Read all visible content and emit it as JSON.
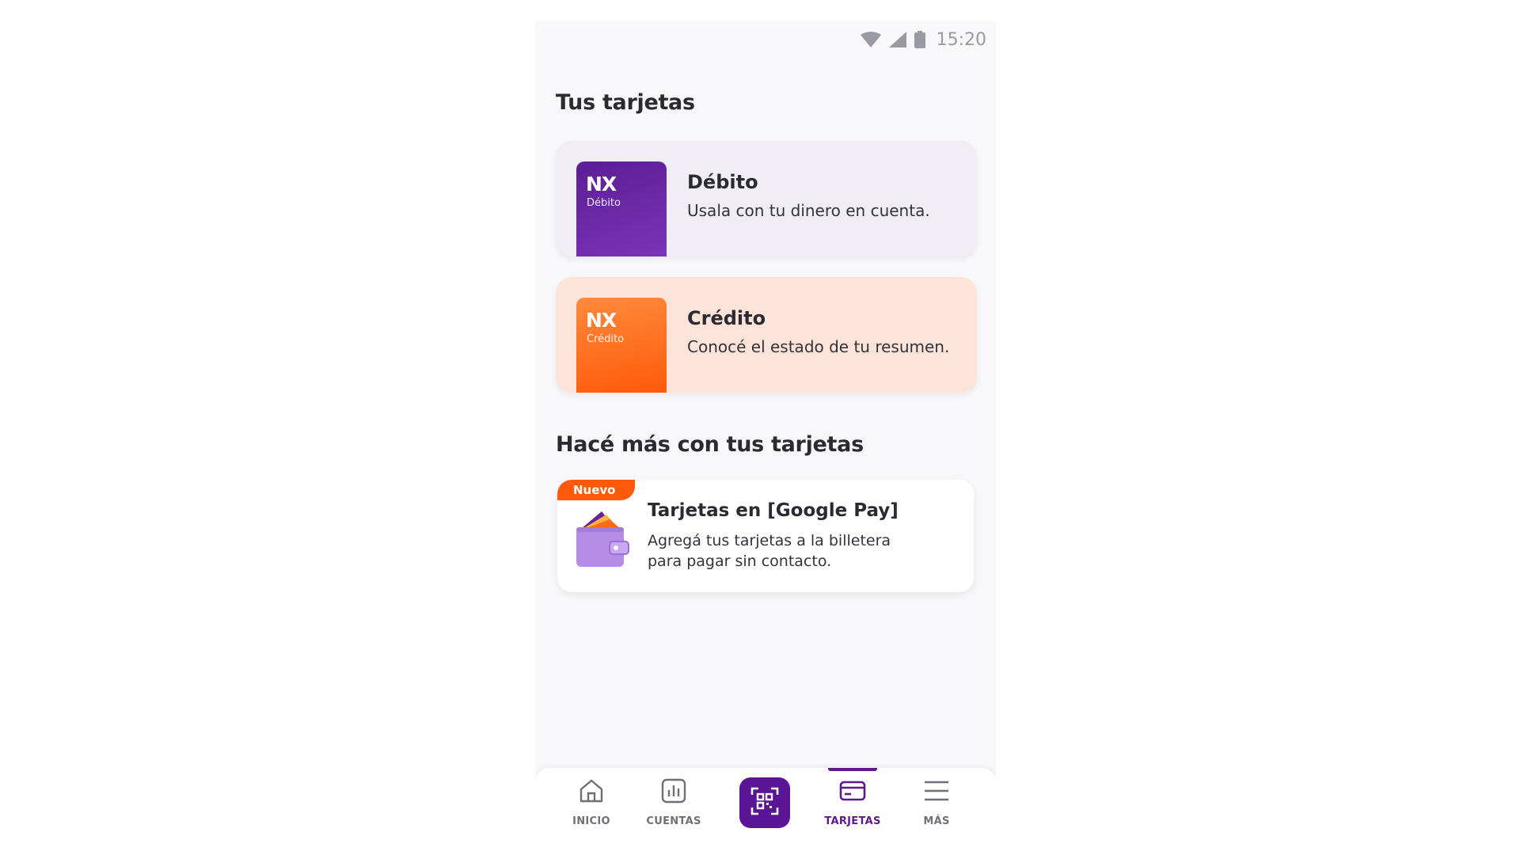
{
  "status_bar": {
    "time": "15:20",
    "icons": [
      "wifi-icon",
      "signal-icon",
      "battery-icon"
    ]
  },
  "cards_section": {
    "title": "Tus tarjetas",
    "cards": [
      {
        "logo": "NX",
        "logo_sub": "Débito",
        "title": "Débito",
        "description": "Usala con tu dinero en cuenta.",
        "color": "#6b2aa8"
      },
      {
        "logo": "NX",
        "logo_sub": "Crédito",
        "title": "Crédito",
        "description": "Conocé el estado de tu resumen.",
        "color": "#ff6a1a"
      }
    ]
  },
  "more_section": {
    "title": "Hacé más con tus tarjetas",
    "promo": {
      "badge": "Nuevo",
      "title": "Tarjetas en [Google Pay]",
      "description": "Agregá tus tarjetas a la billetera para pagar sin contacto.",
      "icon": "wallet-icon"
    }
  },
  "bottom_nav": {
    "items": [
      {
        "label": "INICIO",
        "icon": "home-icon"
      },
      {
        "label": "CUENTAS",
        "icon": "chart-icon"
      },
      {
        "label": "",
        "icon": "qr-scan-icon"
      },
      {
        "label": "TARJETAS",
        "icon": "card-icon",
        "active": true
      },
      {
        "label": "MÁS",
        "icon": "menu-icon"
      }
    ]
  },
  "colors": {
    "brand_purple": "#5a1596",
    "brand_orange": "#ff5a0a",
    "debit_card_bg": "#f0eef4",
    "credit_card_bg": "#fde3d8"
  }
}
